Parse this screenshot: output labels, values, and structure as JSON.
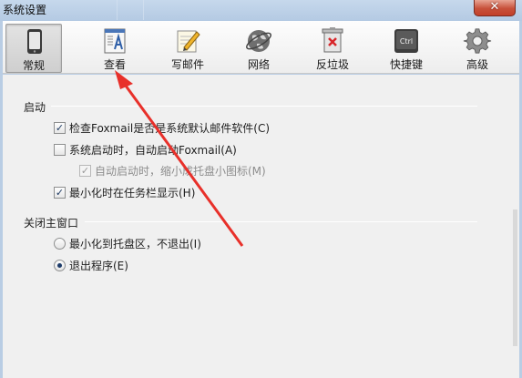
{
  "window": {
    "title": "系统设置",
    "close_glyph": "✕"
  },
  "toolbar": {
    "items": [
      {
        "label": "常规",
        "icon": "phone-icon",
        "selected": true
      },
      {
        "label": "查看",
        "icon": "view-icon",
        "selected": false
      },
      {
        "label": "写邮件",
        "icon": "compose-icon",
        "selected": false
      },
      {
        "label": "网络",
        "icon": "globe-icon",
        "selected": false
      },
      {
        "label": "反垃圾",
        "icon": "antispam-icon",
        "selected": false
      },
      {
        "label": "快捷键",
        "icon": "ctrl-key-icon",
        "selected": false
      },
      {
        "label": "高级",
        "icon": "gear-icon",
        "selected": false
      }
    ],
    "ctrl_text": "Ctrl"
  },
  "startup": {
    "title": "启动",
    "options": [
      {
        "label": "检查Foxmail是否是系统默认邮件软件(C)",
        "checked": true,
        "enabled": true
      },
      {
        "label": "系统启动时，自动启动Foxmail(A)",
        "checked": false,
        "enabled": true
      },
      {
        "label": "自动启动时，缩小成托盘小图标(M)",
        "checked": true,
        "enabled": false
      },
      {
        "label": "最小化时在任务栏显示(H)",
        "checked": true,
        "enabled": true
      }
    ]
  },
  "close_main": {
    "title": "关闭主窗口",
    "options": [
      {
        "label": "最小化到托盘区，不退出(I)",
        "selected": false
      },
      {
        "label": "退出程序(E)",
        "selected": true
      }
    ]
  },
  "colors": {
    "selection_bg": "#d6d6d6",
    "annotation_arrow": "#e8302a",
    "titlebar": "#b9cde4"
  }
}
